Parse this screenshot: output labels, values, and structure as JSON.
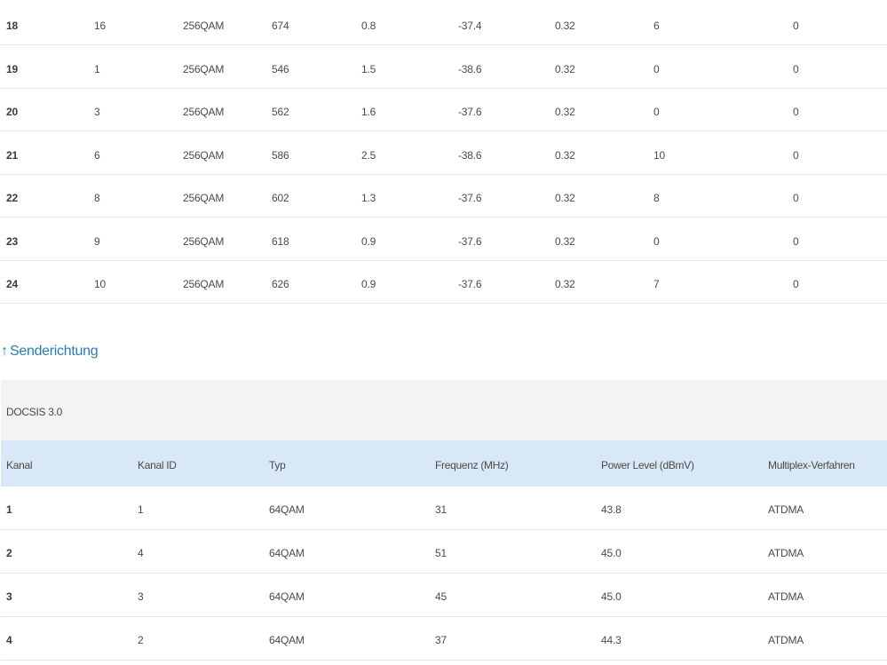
{
  "downstream": {
    "rows": [
      {
        "kanal": "18",
        "kanal_id": "16",
        "typ": "256QAM",
        "freq": "674",
        "power": "0.8",
        "mse": "-37.4",
        "latency": "0.32",
        "corr": "6",
        "noncorr": "0"
      },
      {
        "kanal": "19",
        "kanal_id": "1",
        "typ": "256QAM",
        "freq": "546",
        "power": "1.5",
        "mse": "-38.6",
        "latency": "0.32",
        "corr": "0",
        "noncorr": "0"
      },
      {
        "kanal": "20",
        "kanal_id": "3",
        "typ": "256QAM",
        "freq": "562",
        "power": "1.6",
        "mse": "-37.6",
        "latency": "0.32",
        "corr": "0",
        "noncorr": "0"
      },
      {
        "kanal": "21",
        "kanal_id": "6",
        "typ": "256QAM",
        "freq": "586",
        "power": "2.5",
        "mse": "-38.6",
        "latency": "0.32",
        "corr": "10",
        "noncorr": "0"
      },
      {
        "kanal": "22",
        "kanal_id": "8",
        "typ": "256QAM",
        "freq": "602",
        "power": "1.3",
        "mse": "-37.6",
        "latency": "0.32",
        "corr": "8",
        "noncorr": "0"
      },
      {
        "kanal": "23",
        "kanal_id": "9",
        "typ": "256QAM",
        "freq": "618",
        "power": "0.9",
        "mse": "-37.6",
        "latency": "0.32",
        "corr": "0",
        "noncorr": "0"
      },
      {
        "kanal": "24",
        "kanal_id": "10",
        "typ": "256QAM",
        "freq": "626",
        "power": "0.9",
        "mse": "-37.6",
        "latency": "0.32",
        "corr": "7",
        "noncorr": "0"
      }
    ]
  },
  "upstream": {
    "heading": "Senderichtung",
    "heading_icon": "up-arrow-icon",
    "heading_icon_glyph": "↑",
    "docsis_label": "DOCSIS 3.0",
    "headers": {
      "kanal": "Kanal",
      "kanal_id": "Kanal ID",
      "typ": "Typ",
      "freq": "Frequenz (MHz)",
      "power": "Power Level (dBmV)",
      "multiplex": "Multiplex-Verfahren"
    },
    "rows": [
      {
        "kanal": "1",
        "kanal_id": "1",
        "typ": "64QAM",
        "freq": "31",
        "power": "43.8",
        "multiplex": "ATDMA"
      },
      {
        "kanal": "2",
        "kanal_id": "4",
        "typ": "64QAM",
        "freq": "51",
        "power": "45.0",
        "multiplex": "ATDMA"
      },
      {
        "kanal": "3",
        "kanal_id": "3",
        "typ": "64QAM",
        "freq": "45",
        "power": "45.0",
        "multiplex": "ATDMA"
      },
      {
        "kanal": "4",
        "kanal_id": "2",
        "typ": "64QAM",
        "freq": "37",
        "power": "44.3",
        "multiplex": "ATDMA"
      }
    ]
  },
  "colors": {
    "link": "#2b7ab8",
    "header_bg": "#d8e8f6",
    "docsis_bg": "#f3f3f1",
    "row_border": "#e3e3e3"
  }
}
